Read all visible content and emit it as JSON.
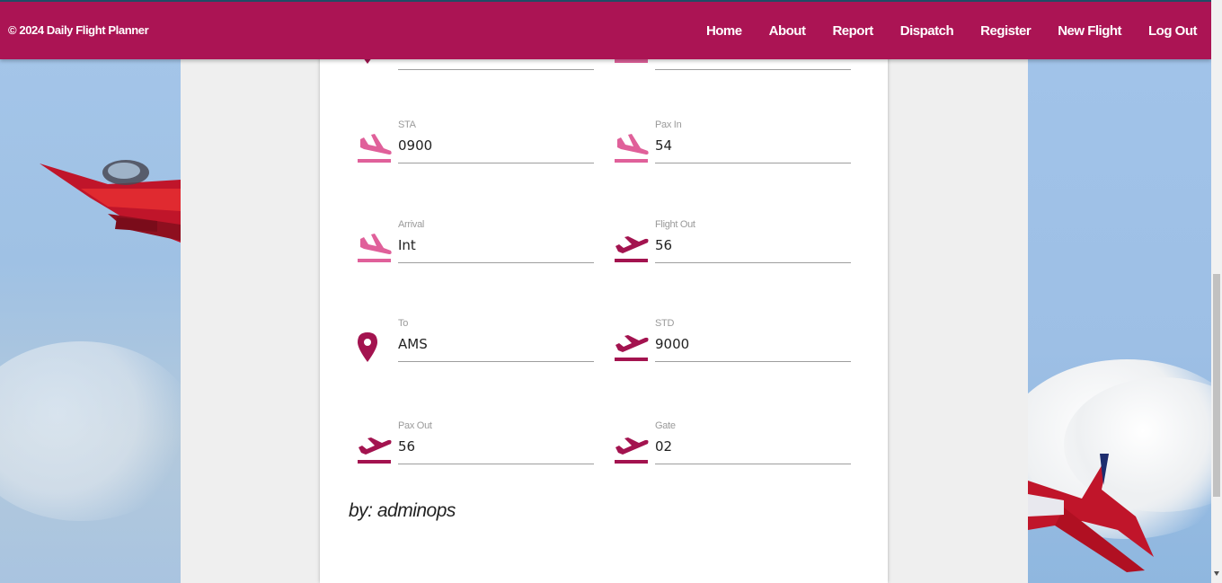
{
  "navbar": {
    "brand": "© 2024 Daily Flight Planner",
    "links": [
      "Home",
      "About",
      "Report",
      "Dispatch",
      "Register",
      "New Flight",
      "Log Out"
    ]
  },
  "form": {
    "fields": [
      {
        "label": "STA",
        "value": "0900",
        "icon": "flight-land-icon"
      },
      {
        "label": "Pax In",
        "value": "54",
        "icon": "flight-land-icon"
      },
      {
        "label": "Arrival",
        "value": "Int",
        "icon": "flight-land-icon"
      },
      {
        "label": "Flight Out",
        "value": "56",
        "icon": "flight-takeoff-icon"
      },
      {
        "label": "To",
        "value": "AMS",
        "icon": "location-pin-icon"
      },
      {
        "label": "STD",
        "value": "9000",
        "icon": "flight-takeoff-icon"
      },
      {
        "label": "Pax Out",
        "value": "56",
        "icon": "flight-takeoff-icon"
      },
      {
        "label": "Gate",
        "value": "02",
        "icon": "flight-takeoff-icon"
      }
    ],
    "byline": "by: adminops"
  },
  "colors": {
    "brand": "#ab1454",
    "icon_land": "#e0609a",
    "icon_takeoff": "#a3134f"
  }
}
